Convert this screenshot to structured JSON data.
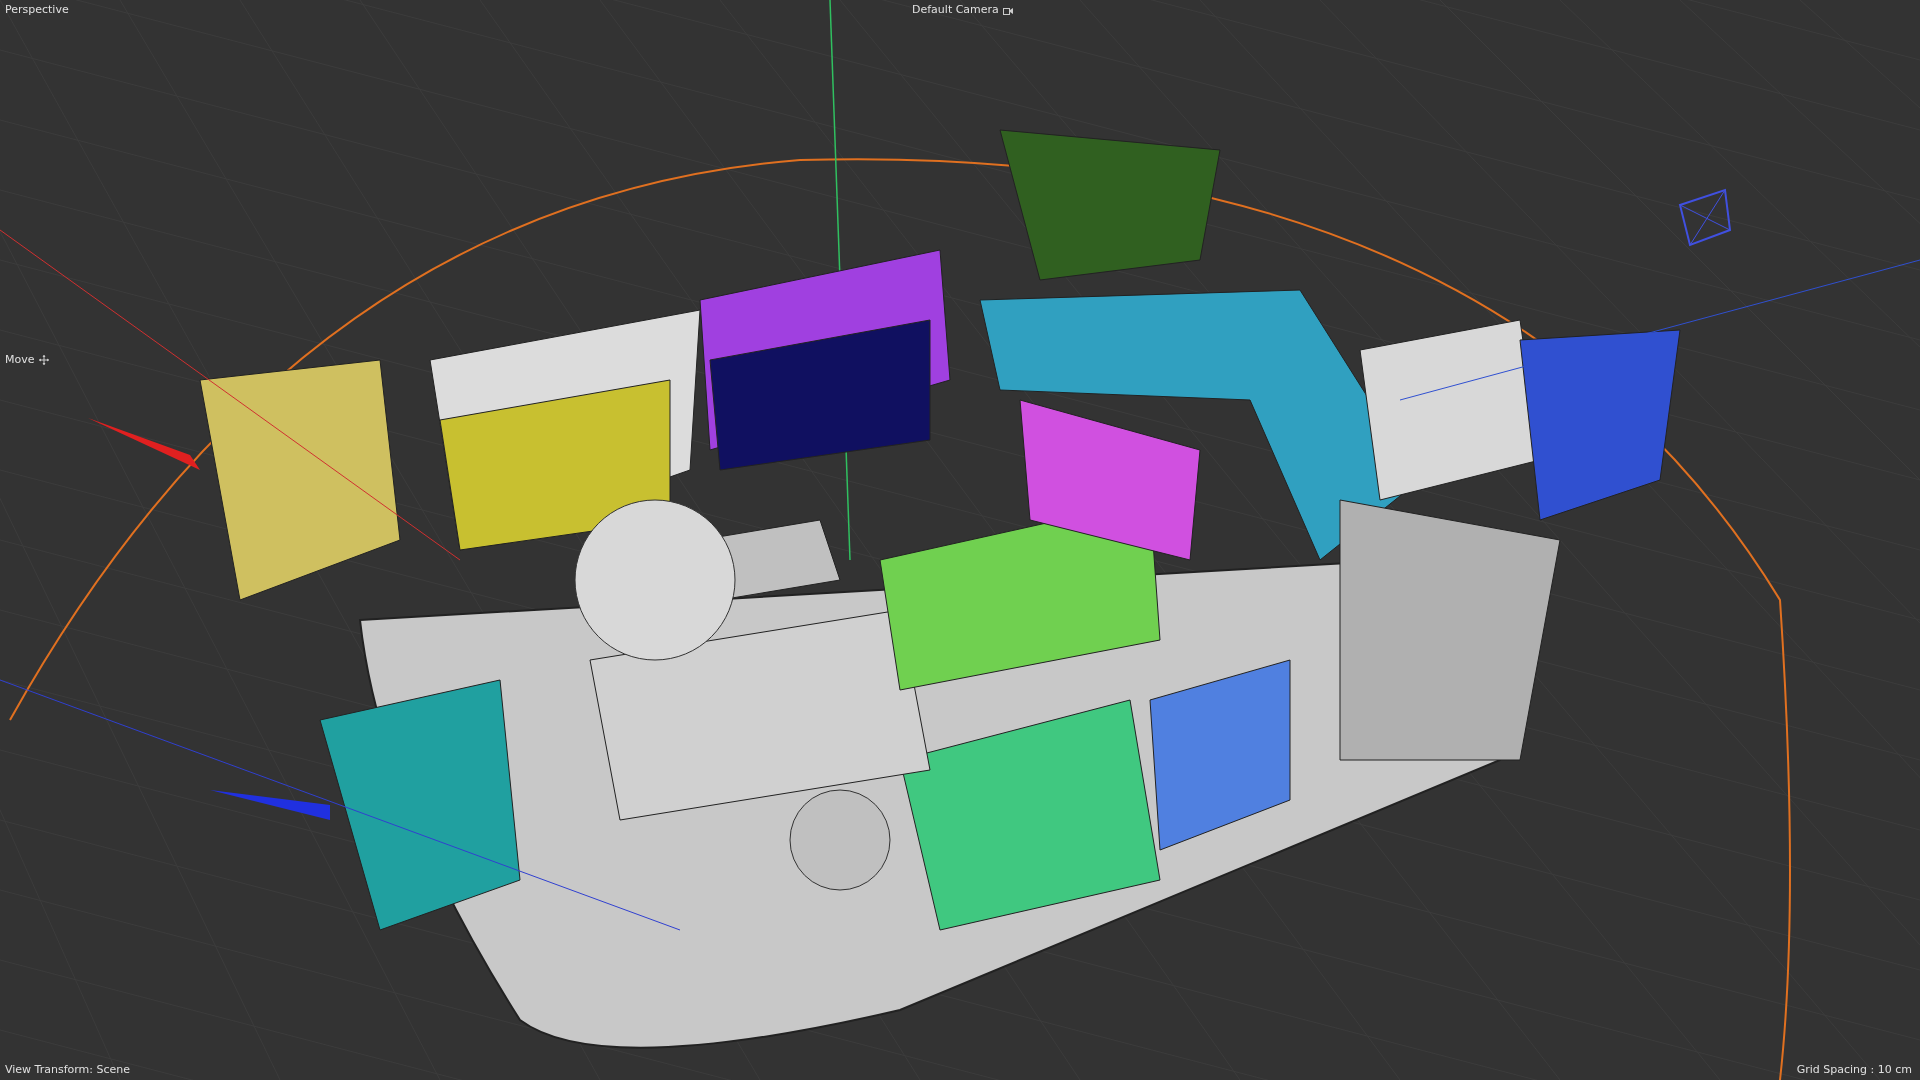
{
  "viewport": {
    "view_label": "Perspective",
    "camera": "Default Camera",
    "tool": "Move",
    "view_transform": "View Transform: Scene",
    "grid_spacing": "Grid Spacing : 10 cm"
  }
}
